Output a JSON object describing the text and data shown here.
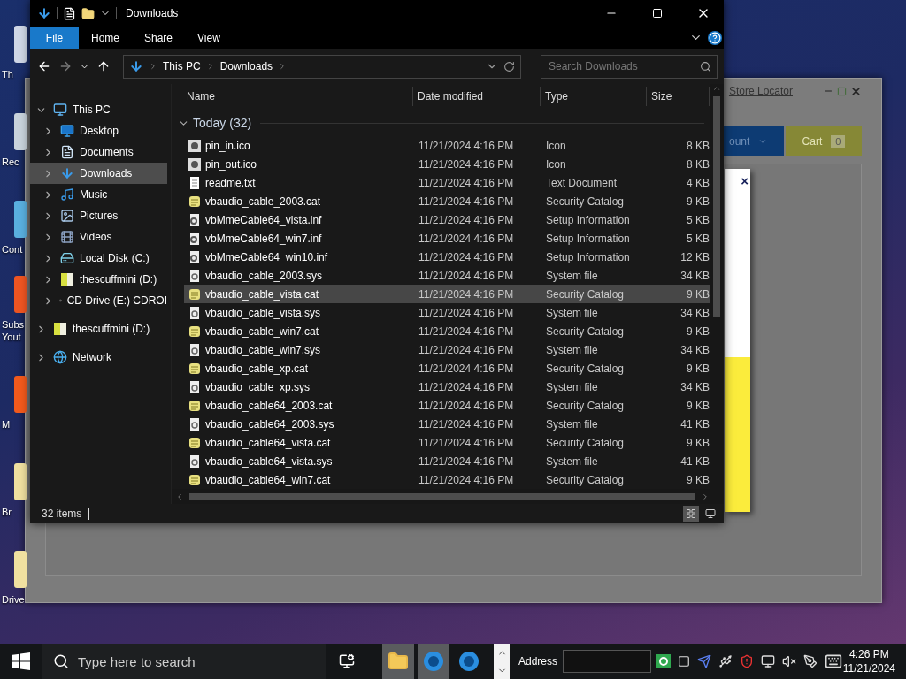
{
  "desktop_icons": [
    {
      "kind": "app",
      "label": "Th"
    },
    {
      "kind": "recycle",
      "label": "Rec"
    },
    {
      "kind": "control",
      "label": "Cont"
    },
    {
      "kind": "video",
      "label": "Subs Yout"
    },
    {
      "kind": "media",
      "label": "M"
    },
    {
      "kind": "folder",
      "label": "Br"
    },
    {
      "kind": "folder",
      "label": "Drive"
    }
  ],
  "background_window": {
    "link": "Store Locator",
    "account_button": "ount",
    "cart_button": {
      "label": "Cart",
      "count": "0"
    },
    "popup": {
      "close": "×"
    }
  },
  "explorer": {
    "title": "Downloads",
    "ribbon_tabs": [
      {
        "label": "File",
        "selected": true
      },
      {
        "label": "Home",
        "selected": false
      },
      {
        "label": "Share",
        "selected": false
      },
      {
        "label": "View",
        "selected": false
      }
    ],
    "breadcrumb": [
      "This PC",
      "Downloads"
    ],
    "search": {
      "placeholder": "Search Downloads"
    },
    "tree": [
      {
        "kind": "pc",
        "label": "This PC",
        "expanded": true,
        "selected": false,
        "children": [
          {
            "kind": "desktop",
            "label": "Desktop",
            "expanded": false,
            "selected": false
          },
          {
            "kind": "documents",
            "label": "Documents",
            "expanded": false,
            "selected": false
          },
          {
            "kind": "downloads",
            "label": "Downloads",
            "expanded": false,
            "selected": true
          },
          {
            "kind": "music",
            "label": "Music",
            "expanded": false,
            "selected": false
          },
          {
            "kind": "pictures",
            "label": "Pictures",
            "expanded": false,
            "selected": false
          },
          {
            "kind": "videos",
            "label": "Videos",
            "expanded": false,
            "selected": false
          },
          {
            "kind": "disk",
            "label": "Local Disk (C:)",
            "expanded": false,
            "selected": false
          },
          {
            "kind": "usb",
            "label": "thescuffmini (D:)",
            "expanded": false,
            "selected": false
          },
          {
            "kind": "cd",
            "label": "CD Drive (E:) CDROI",
            "expanded": false,
            "selected": false
          }
        ]
      },
      {
        "kind": "usb",
        "label": "thescuffmini (D:)",
        "expanded": false,
        "selected": false
      },
      {
        "kind": "network",
        "label": "Network",
        "expanded": false,
        "selected": false
      }
    ],
    "columns": [
      "Name",
      "Date modified",
      "Type",
      "Size"
    ],
    "group": "Today (32)",
    "files": [
      {
        "kind": "image",
        "name": "pin_in.ico",
        "date": "11/21/2024 4:16 PM",
        "type": "Icon",
        "size": "8 KB",
        "selected": false
      },
      {
        "kind": "image",
        "name": "pin_out.ico",
        "date": "11/21/2024 4:16 PM",
        "type": "Icon",
        "size": "8 KB",
        "selected": false
      },
      {
        "kind": "text",
        "name": "readme.txt",
        "date": "11/21/2024 4:16 PM",
        "type": "Text Document",
        "size": "4 KB",
        "selected": false
      },
      {
        "kind": "catalog",
        "name": "vbaudio_cable_2003.cat",
        "date": "11/21/2024 4:16 PM",
        "type": "Security Catalog",
        "size": "9 KB",
        "selected": false
      },
      {
        "kind": "setup",
        "name": "vbMmeCable64_vista.inf",
        "date": "11/21/2024 4:16 PM",
        "type": "Setup Information",
        "size": "5 KB",
        "selected": false
      },
      {
        "kind": "setup",
        "name": "vbMmeCable64_win7.inf",
        "date": "11/21/2024 4:16 PM",
        "type": "Setup Information",
        "size": "5 KB",
        "selected": false
      },
      {
        "kind": "setup",
        "name": "vbMmeCable64_win10.inf",
        "date": "11/21/2024 4:16 PM",
        "type": "Setup Information",
        "size": "12 KB",
        "selected": false
      },
      {
        "kind": "system",
        "name": "vbaudio_cable_2003.sys",
        "date": "11/21/2024 4:16 PM",
        "type": "System file",
        "size": "34 KB",
        "selected": false
      },
      {
        "kind": "catalog",
        "name": "vbaudio_cable_vista.cat",
        "date": "11/21/2024 4:16 PM",
        "type": "Security Catalog",
        "size": "9 KB",
        "selected": true
      },
      {
        "kind": "system",
        "name": "vbaudio_cable_vista.sys",
        "date": "11/21/2024 4:16 PM",
        "type": "System file",
        "size": "34 KB",
        "selected": false
      },
      {
        "kind": "catalog",
        "name": "vbaudio_cable_win7.cat",
        "date": "11/21/2024 4:16 PM",
        "type": "Security Catalog",
        "size": "9 KB",
        "selected": false
      },
      {
        "kind": "system",
        "name": "vbaudio_cable_win7.sys",
        "date": "11/21/2024 4:16 PM",
        "type": "System file",
        "size": "34 KB",
        "selected": false
      },
      {
        "kind": "catalog",
        "name": "vbaudio_cable_xp.cat",
        "date": "11/21/2024 4:16 PM",
        "type": "Security Catalog",
        "size": "9 KB",
        "selected": false
      },
      {
        "kind": "system",
        "name": "vbaudio_cable_xp.sys",
        "date": "11/21/2024 4:16 PM",
        "type": "System file",
        "size": "34 KB",
        "selected": false
      },
      {
        "kind": "catalog",
        "name": "vbaudio_cable64_2003.cat",
        "date": "11/21/2024 4:16 PM",
        "type": "Security Catalog",
        "size": "9 KB",
        "selected": false
      },
      {
        "kind": "system",
        "name": "vbaudio_cable64_2003.sys",
        "date": "11/21/2024 4:16 PM",
        "type": "System file",
        "size": "41 KB",
        "selected": false
      },
      {
        "kind": "catalog",
        "name": "vbaudio_cable64_vista.cat",
        "date": "11/21/2024 4:16 PM",
        "type": "Security Catalog",
        "size": "9 KB",
        "selected": false
      },
      {
        "kind": "system",
        "name": "vbaudio_cable64_vista.sys",
        "date": "11/21/2024 4:16 PM",
        "type": "System file",
        "size": "41 KB",
        "selected": false
      },
      {
        "kind": "catalog",
        "name": "vbaudio_cable64_win7.cat",
        "date": "11/21/2024 4:16 PM",
        "type": "Security Catalog",
        "size": "9 KB",
        "selected": false
      }
    ],
    "status": "32 items"
  },
  "taskbar": {
    "search_placeholder": "Type here to search",
    "apps": [
      {
        "kind": "folder",
        "selected": true
      },
      {
        "kind": "browser",
        "selected": true
      },
      {
        "kind": "browser",
        "selected": false
      }
    ],
    "address_label": "Address",
    "time": "4:26 PM",
    "date": "11/21/2024"
  }
}
